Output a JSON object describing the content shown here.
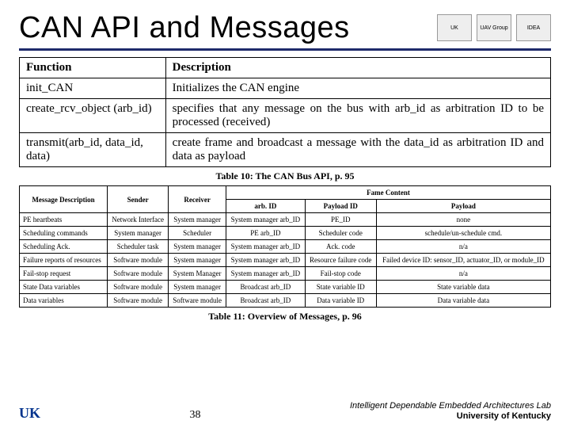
{
  "title": "CAN API and Messages",
  "logos": [
    "UK",
    "UAV Group",
    "IDEA"
  ],
  "table10": {
    "header": {
      "c0": "Function",
      "c1": "Description"
    },
    "rows": [
      {
        "fn": "init_CAN",
        "desc": "Initializes the CAN engine"
      },
      {
        "fn": "create_rcv_object (arb_id)",
        "desc": "specifies that any message on the bus with arb_id as arbitration ID to be processed (received)"
      },
      {
        "fn": "transmit(arb_id, data_id, data)",
        "desc": "create frame and broadcast a message with the data_id as arbitration ID and data as payload"
      }
    ],
    "caption": "Table 10: The CAN Bus API, p. 95"
  },
  "table11": {
    "header": {
      "msg": "Message Description",
      "sender": "Sender",
      "receiver": "Receiver",
      "frame": "Fame Content",
      "arb": "arb. ID",
      "payloadId": "Payload ID",
      "payload": "Payload"
    },
    "rows": [
      {
        "msg": "PE heartbeats",
        "sender": "Network Interface",
        "receiver": "System manager",
        "arb": "System manager arb_ID",
        "payloadId": "PE_ID",
        "payload": "none"
      },
      {
        "msg": "Scheduling commands",
        "sender": "System manager",
        "receiver": "Scheduler",
        "arb": "PE arb_ID",
        "payloadId": "Scheduler code",
        "payload": "schedule/un-schedule cmd."
      },
      {
        "msg": "Scheduling Ack.",
        "sender": "Scheduler task",
        "receiver": "System manager",
        "arb": "System manager arb_ID",
        "payloadId": "Ack. code",
        "payload": "n/a"
      },
      {
        "msg": "Failure reports of resources",
        "sender": "Software module",
        "receiver": "System manager",
        "arb": "System manager arb_ID",
        "payloadId": "Resource failure code",
        "payload": "Failed device ID: sensor_ID, actuator_ID, or module_ID"
      },
      {
        "msg": "Fail-stop request",
        "sender": "Software module",
        "receiver": "System Manager",
        "arb": "System manager arb_ID",
        "payloadId": "Fail-stop code",
        "payload": "n/a"
      },
      {
        "msg": "State Data variables",
        "sender": "Software module",
        "receiver": "System manager",
        "arb": "Broadcast arb_ID",
        "payloadId": "State variable ID",
        "payload": "State variable data"
      },
      {
        "msg": "Data variables",
        "sender": "Software module",
        "receiver": "Software module",
        "arb": "Broadcast arb_ID",
        "payloadId": "Data variable ID",
        "payload": "Data variable data"
      }
    ],
    "caption": "Table 11: Overview of Messages, p. 96"
  },
  "footer": {
    "uk": "UK",
    "pageNum": "38",
    "labLine1": "Intelligent Dependable Embedded Architectures Lab",
    "labLine2": "University of Kentucky"
  }
}
